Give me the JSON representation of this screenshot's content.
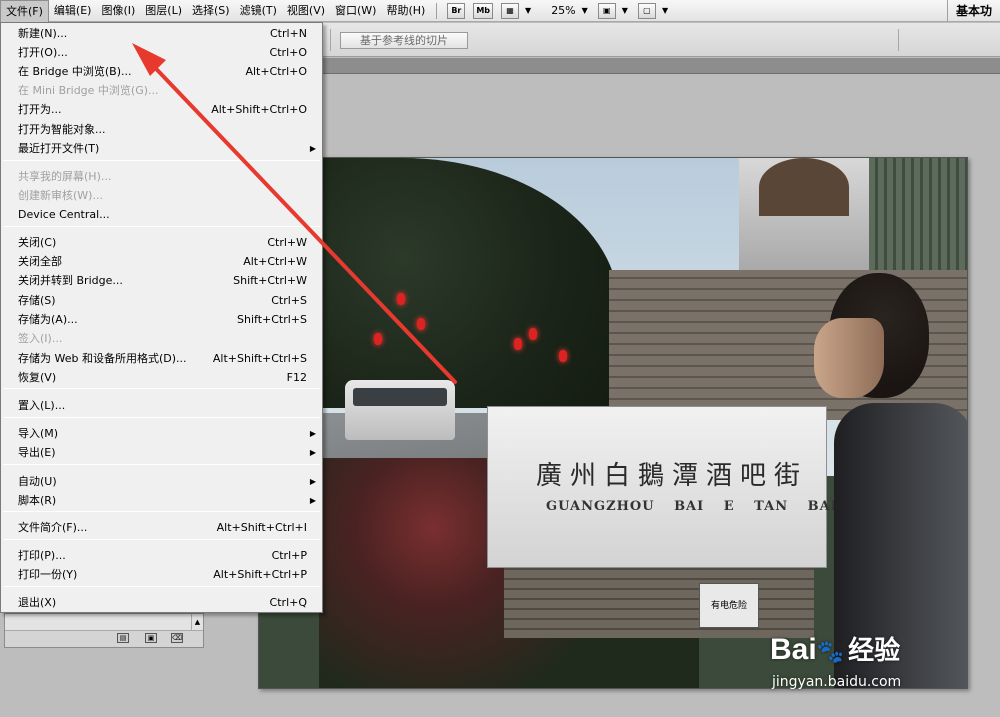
{
  "menubar": {
    "items": [
      "文件(F)",
      "编辑(E)",
      "图像(I)",
      "图层(L)",
      "选择(S)",
      "滤镜(T)",
      "视图(V)",
      "窗口(W)",
      "帮助(H)"
    ],
    "icons": [
      "Br",
      "Mb"
    ],
    "zoom": "25%",
    "workspace": "基本功"
  },
  "options_bar": {
    "slice_button": "基于参考线的切片"
  },
  "file_menu": {
    "items": [
      {
        "label": "新建(N)...",
        "shortcut": "Ctrl+N",
        "disabled": false
      },
      {
        "label": "打开(O)...",
        "shortcut": "Ctrl+O",
        "disabled": false
      },
      {
        "label": "在 Bridge 中浏览(B)...",
        "shortcut": "Alt+Ctrl+O",
        "disabled": false
      },
      {
        "label": "在 Mini Bridge 中浏览(G)...",
        "shortcut": "",
        "disabled": true
      },
      {
        "label": "打开为...",
        "shortcut": "Alt+Shift+Ctrl+O",
        "disabled": false
      },
      {
        "label": "打开为智能对象...",
        "shortcut": "",
        "disabled": false
      },
      {
        "label": "最近打开文件(T)",
        "shortcut": "",
        "disabled": false,
        "submenu": true
      },
      {
        "label": "共享我的屏幕(H)...",
        "shortcut": "",
        "disabled": true
      },
      {
        "label": "创建新审核(W)...",
        "shortcut": "",
        "disabled": true
      },
      {
        "label": "Device Central...",
        "shortcut": "",
        "disabled": false
      },
      {
        "label": "关闭(C)",
        "shortcut": "Ctrl+W",
        "disabled": false
      },
      {
        "label": "关闭全部",
        "shortcut": "Alt+Ctrl+W",
        "disabled": false
      },
      {
        "label": "关闭并转到 Bridge...",
        "shortcut": "Shift+Ctrl+W",
        "disabled": false
      },
      {
        "label": "存储(S)",
        "shortcut": "Ctrl+S",
        "disabled": false
      },
      {
        "label": "存储为(A)...",
        "shortcut": "Shift+Ctrl+S",
        "disabled": false
      },
      {
        "label": "签入(I)...",
        "shortcut": "",
        "disabled": true
      },
      {
        "label": "存储为 Web 和设备所用格式(D)...",
        "shortcut": "Alt+Shift+Ctrl+S",
        "disabled": false
      },
      {
        "label": "恢复(V)",
        "shortcut": "F12",
        "disabled": false
      },
      {
        "label": "置入(L)...",
        "shortcut": "",
        "disabled": false
      },
      {
        "label": "导入(M)",
        "shortcut": "",
        "disabled": false,
        "submenu": true
      },
      {
        "label": "导出(E)",
        "shortcut": "",
        "disabled": false,
        "submenu": true
      },
      {
        "label": "自动(U)",
        "shortcut": "",
        "disabled": false,
        "submenu": true
      },
      {
        "label": "脚本(R)",
        "shortcut": "",
        "disabled": false,
        "submenu": true
      },
      {
        "label": "文件简介(F)...",
        "shortcut": "Alt+Shift+Ctrl+I",
        "disabled": false
      },
      {
        "label": "打印(P)...",
        "shortcut": "Ctrl+P",
        "disabled": false
      },
      {
        "label": "打印一份(Y)",
        "shortcut": "Alt+Shift+Ctrl+P",
        "disabled": false
      },
      {
        "label": "退出(X)",
        "shortcut": "Ctrl+Q",
        "disabled": false
      }
    ]
  },
  "photo": {
    "sign_chinese": "廣州白鵝潭酒吧街",
    "sign_english": "GUANGZHOU BAI E TAN BAR STREET",
    "warning_label": "有电危险"
  },
  "watermark": {
    "logo": "Bai",
    "logo_suffix": "经验",
    "url": "jingyan.baidu.com"
  },
  "colors": {
    "arrow": "#e8392f",
    "menu_bg": "#f0f0f0",
    "disabled": "#a0a0a0"
  }
}
